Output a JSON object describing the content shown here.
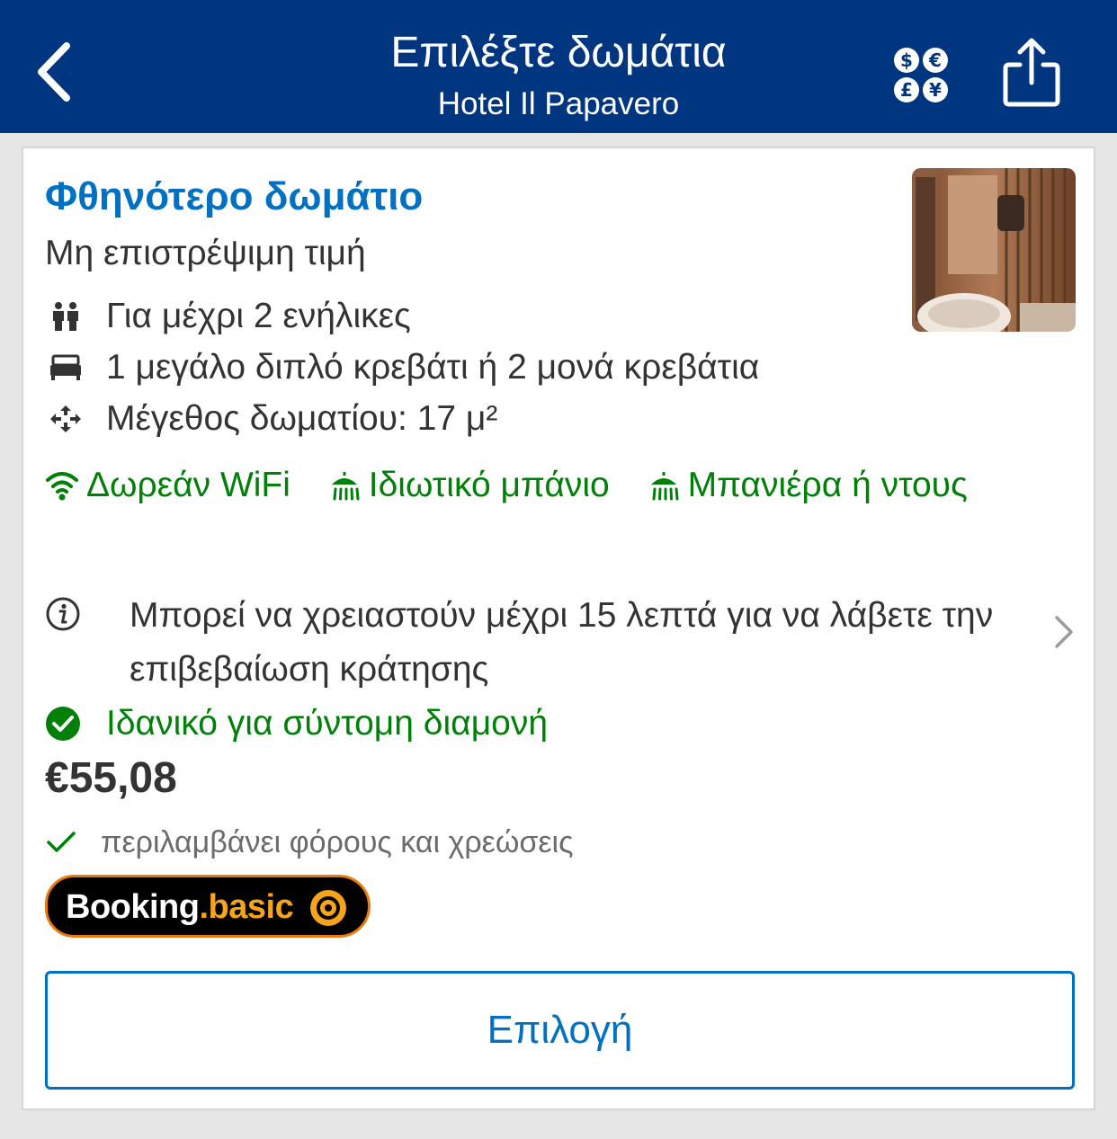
{
  "header": {
    "title": "Επιλέξτε δωμάτια",
    "subtitle": "Hotel Il Papavero",
    "currency_symbols": [
      "$",
      "€",
      "£",
      "¥"
    ]
  },
  "room": {
    "title": "Φθηνότερο δωμάτιο",
    "policy": "Μη επιστρέψιμη τιμή",
    "occupancy": "Για μέχρι 2 ενήλικες",
    "beds": "1 μεγάλο διπλό κρεβάτι ή 2 μονά κρεβάτια",
    "size": "Μέγεθος δωματίου: 17 μ²",
    "amenities": [
      "Δωρεάν WiFi",
      "Ιδιωτικό μπάνιο",
      "Μπανιέρα ή ντους"
    ],
    "info": "Μπορεί να χρειαστούν μέχρι 15 λεπτά για να λάβετε την επιβεβαίωση κράτησης",
    "ideal": "Ιδανικό για σύντομη διαμονή",
    "price": "€55,08",
    "tax_note": "περιλαμβάνει φόρους και χρεώσεις",
    "badge": {
      "brand": "Booking",
      "dot": ".",
      "tier": "basic"
    },
    "select_label": "Επιλογή"
  },
  "colors": {
    "header_bg": "#003580",
    "link_blue": "#0071c2",
    "success_green": "#008009",
    "badge_orange": "#f6a41b"
  },
  "icons": [
    "chevron-left-icon",
    "currency-icon",
    "share-icon",
    "people-icon",
    "bed-icon",
    "room-size-icon",
    "wifi-icon",
    "shower-icon",
    "info-icon",
    "chevron-right-icon",
    "check-circle-icon",
    "check-icon",
    "target-icon"
  ]
}
